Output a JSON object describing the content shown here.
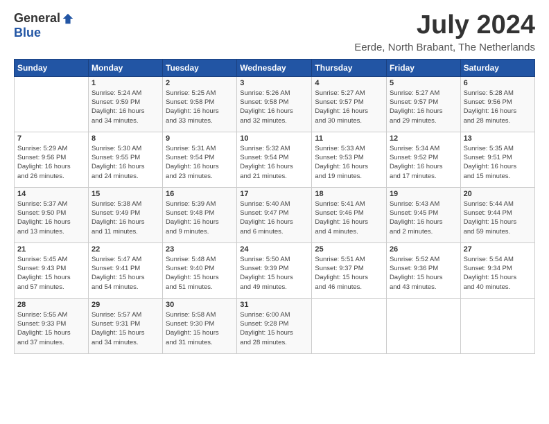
{
  "logo": {
    "general": "General",
    "blue": "Blue"
  },
  "title": "July 2024",
  "location": "Eerde, North Brabant, The Netherlands",
  "headers": [
    "Sunday",
    "Monday",
    "Tuesday",
    "Wednesday",
    "Thursday",
    "Friday",
    "Saturday"
  ],
  "weeks": [
    [
      {
        "day": "",
        "info": ""
      },
      {
        "day": "1",
        "info": "Sunrise: 5:24 AM\nSunset: 9:59 PM\nDaylight: 16 hours\nand 34 minutes."
      },
      {
        "day": "2",
        "info": "Sunrise: 5:25 AM\nSunset: 9:58 PM\nDaylight: 16 hours\nand 33 minutes."
      },
      {
        "day": "3",
        "info": "Sunrise: 5:26 AM\nSunset: 9:58 PM\nDaylight: 16 hours\nand 32 minutes."
      },
      {
        "day": "4",
        "info": "Sunrise: 5:27 AM\nSunset: 9:57 PM\nDaylight: 16 hours\nand 30 minutes."
      },
      {
        "day": "5",
        "info": "Sunrise: 5:27 AM\nSunset: 9:57 PM\nDaylight: 16 hours\nand 29 minutes."
      },
      {
        "day": "6",
        "info": "Sunrise: 5:28 AM\nSunset: 9:56 PM\nDaylight: 16 hours\nand 28 minutes."
      }
    ],
    [
      {
        "day": "7",
        "info": "Sunrise: 5:29 AM\nSunset: 9:56 PM\nDaylight: 16 hours\nand 26 minutes."
      },
      {
        "day": "8",
        "info": "Sunrise: 5:30 AM\nSunset: 9:55 PM\nDaylight: 16 hours\nand 24 minutes."
      },
      {
        "day": "9",
        "info": "Sunrise: 5:31 AM\nSunset: 9:54 PM\nDaylight: 16 hours\nand 23 minutes."
      },
      {
        "day": "10",
        "info": "Sunrise: 5:32 AM\nSunset: 9:54 PM\nDaylight: 16 hours\nand 21 minutes."
      },
      {
        "day": "11",
        "info": "Sunrise: 5:33 AM\nSunset: 9:53 PM\nDaylight: 16 hours\nand 19 minutes."
      },
      {
        "day": "12",
        "info": "Sunrise: 5:34 AM\nSunset: 9:52 PM\nDaylight: 16 hours\nand 17 minutes."
      },
      {
        "day": "13",
        "info": "Sunrise: 5:35 AM\nSunset: 9:51 PM\nDaylight: 16 hours\nand 15 minutes."
      }
    ],
    [
      {
        "day": "14",
        "info": "Sunrise: 5:37 AM\nSunset: 9:50 PM\nDaylight: 16 hours\nand 13 minutes."
      },
      {
        "day": "15",
        "info": "Sunrise: 5:38 AM\nSunset: 9:49 PM\nDaylight: 16 hours\nand 11 minutes."
      },
      {
        "day": "16",
        "info": "Sunrise: 5:39 AM\nSunset: 9:48 PM\nDaylight: 16 hours\nand 9 minutes."
      },
      {
        "day": "17",
        "info": "Sunrise: 5:40 AM\nSunset: 9:47 PM\nDaylight: 16 hours\nand 6 minutes."
      },
      {
        "day": "18",
        "info": "Sunrise: 5:41 AM\nSunset: 9:46 PM\nDaylight: 16 hours\nand 4 minutes."
      },
      {
        "day": "19",
        "info": "Sunrise: 5:43 AM\nSunset: 9:45 PM\nDaylight: 16 hours\nand 2 minutes."
      },
      {
        "day": "20",
        "info": "Sunrise: 5:44 AM\nSunset: 9:44 PM\nDaylight: 15 hours\nand 59 minutes."
      }
    ],
    [
      {
        "day": "21",
        "info": "Sunrise: 5:45 AM\nSunset: 9:43 PM\nDaylight: 15 hours\nand 57 minutes."
      },
      {
        "day": "22",
        "info": "Sunrise: 5:47 AM\nSunset: 9:41 PM\nDaylight: 15 hours\nand 54 minutes."
      },
      {
        "day": "23",
        "info": "Sunrise: 5:48 AM\nSunset: 9:40 PM\nDaylight: 15 hours\nand 51 minutes."
      },
      {
        "day": "24",
        "info": "Sunrise: 5:50 AM\nSunset: 9:39 PM\nDaylight: 15 hours\nand 49 minutes."
      },
      {
        "day": "25",
        "info": "Sunrise: 5:51 AM\nSunset: 9:37 PM\nDaylight: 15 hours\nand 46 minutes."
      },
      {
        "day": "26",
        "info": "Sunrise: 5:52 AM\nSunset: 9:36 PM\nDaylight: 15 hours\nand 43 minutes."
      },
      {
        "day": "27",
        "info": "Sunrise: 5:54 AM\nSunset: 9:34 PM\nDaylight: 15 hours\nand 40 minutes."
      }
    ],
    [
      {
        "day": "28",
        "info": "Sunrise: 5:55 AM\nSunset: 9:33 PM\nDaylight: 15 hours\nand 37 minutes."
      },
      {
        "day": "29",
        "info": "Sunrise: 5:57 AM\nSunset: 9:31 PM\nDaylight: 15 hours\nand 34 minutes."
      },
      {
        "day": "30",
        "info": "Sunrise: 5:58 AM\nSunset: 9:30 PM\nDaylight: 15 hours\nand 31 minutes."
      },
      {
        "day": "31",
        "info": "Sunrise: 6:00 AM\nSunset: 9:28 PM\nDaylight: 15 hours\nand 28 minutes."
      },
      {
        "day": "",
        "info": ""
      },
      {
        "day": "",
        "info": ""
      },
      {
        "day": "",
        "info": ""
      }
    ]
  ]
}
